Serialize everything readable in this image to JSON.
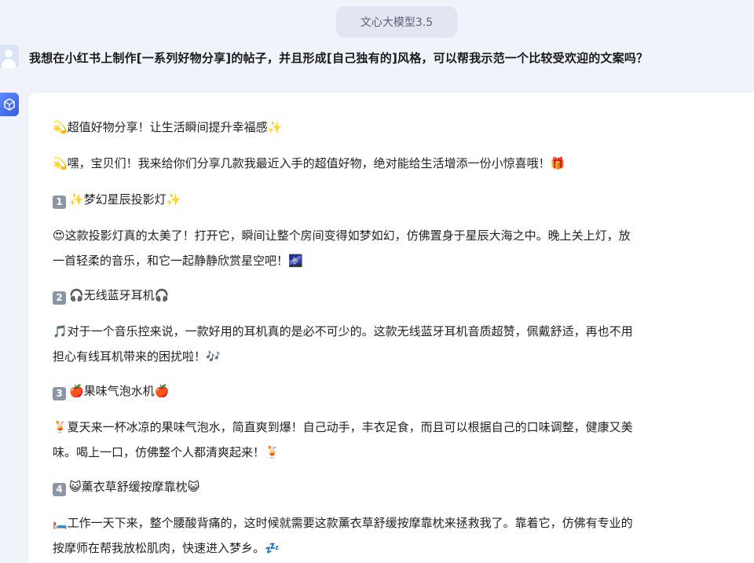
{
  "header": {
    "model_name": "文心大模型3.5"
  },
  "user_message": {
    "avatar_icon": "user-avatar-icon",
    "text": "我想在小红书上制作[一系列好物分享]的帖子，并且形成[自己独有的]风格，可以帮我示范一个比较受欢迎的文案吗？"
  },
  "assistant": {
    "avatar_icon": "cube-logo-icon",
    "title": "💫超值好物分享！让生活瞬间提升幸福感✨",
    "intro": "💫嘿，宝贝们！我来给你们分享几款我最近入手的超值好物，绝对能给生活增添一份小惊喜哦！🎁",
    "items": [
      {
        "num": "1",
        "heading": "✨梦幻星辰投影灯✨",
        "desc_line1": "😍这款投影灯真的太美了！打开它，瞬间让整个房间变得如梦如幻，仿佛置身于星辰大海之中。晚上关上灯，放",
        "desc_line2": "一首轻柔的音乐，和它一起静静欣赏星空吧！🌌"
      },
      {
        "num": "2",
        "heading": "🎧无线蓝牙耳机🎧",
        "desc_line1": "🎵对于一个音乐控来说，一款好用的耳机真的是必不可少的。这款无线蓝牙耳机音质超赞，佩戴舒适，再也不用",
        "desc_line2": "担心有线耳机带来的困扰啦！🎶"
      },
      {
        "num": "3",
        "heading": "🍎果味气泡水机🍎",
        "desc_line1": "🍹夏天来一杯冰凉的果味气泡水，简直爽到爆！自己动手，丰衣足食，而且可以根据自己的口味调整，健康又美",
        "desc_line2": "味。喝上一口，仿佛整个人都清爽起来！🍹"
      },
      {
        "num": "4",
        "heading": "😺薰衣草舒缓按摩靠枕😺",
        "desc_line1": "🛏️工作一天下来，整个腰酸背痛的，这时候就需要这款薰衣草舒缓按摩靠枕来拯救我了。靠着它，仿佛有专业的",
        "desc_line2": "按摩师在帮我放松肌肉，快速进入梦乡。💤"
      }
    ]
  }
}
